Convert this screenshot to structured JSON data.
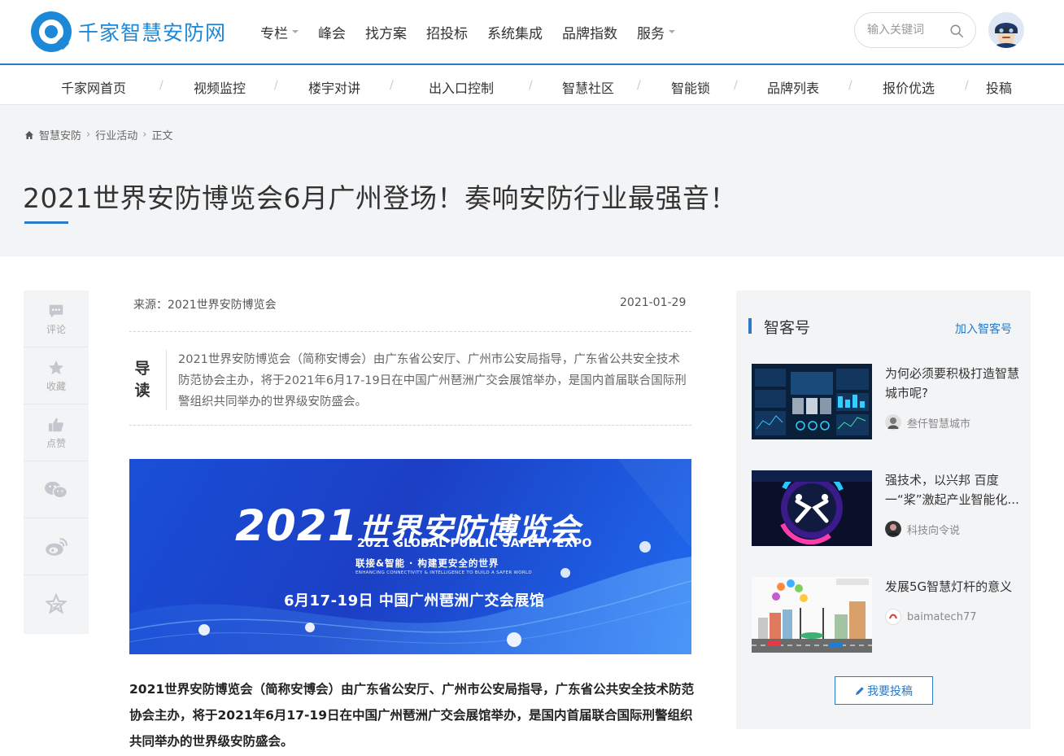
{
  "brand": {
    "name": "千家智慧安防网",
    "color": "#1e88d8",
    "accent": "#2a7ac7"
  },
  "main_nav": [
    {
      "label": "专栏",
      "has_dropdown": true
    },
    {
      "label": "峰会",
      "has_dropdown": false
    },
    {
      "label": "找方案",
      "has_dropdown": false
    },
    {
      "label": "招投标",
      "has_dropdown": false
    },
    {
      "label": "系统集成",
      "has_dropdown": false
    },
    {
      "label": "品牌指数",
      "has_dropdown": false
    },
    {
      "label": "服务",
      "has_dropdown": true
    }
  ],
  "search": {
    "placeholder": "输入关键词",
    "icon": "search-icon"
  },
  "sub_nav": [
    "千家网首页",
    "视频监控",
    "楼宇对讲",
    "出入口控制",
    "智慧社区",
    "智能锁",
    "品牌列表",
    "报价优选",
    "投稿"
  ],
  "breadcrumb": {
    "items": [
      "智慧安防",
      "行业活动",
      "正文"
    ]
  },
  "article": {
    "title": "2021世界安防博览会6月广州登场！奏响安防行业最强音！",
    "source": "来源：2021世界安防博览会",
    "date": "2021-01-29",
    "lead_label": "导读",
    "lead_text": "2021世界安防博览会（简称安博会）由广东省公安厅、广州市公安局指导，广东省公共安全技术防范协会主办，将于2021年6月17-19日在中国广州琶洲广交会展馆举办，是国内首届联合国际刑警组织共同举办的世界级安防盛会。",
    "body": "2021世界安防博览会（简称安博会）由广东省公安厅、广州市公安局指导，广东省公共安全技术防范协会主办，将于2021年6月17-19日在中国广州琶洲广交会展馆举办，是国内首届联合国际刑警组织共同举办的世界级安防盛会。"
  },
  "banner": {
    "year": "2021",
    "title_cn": "世界安防博览会",
    "title_en": "2021 GLOBAL PUBLIC SAFETY EXPO",
    "slogan": "联接&智能 · 构建更安全的世界",
    "slogan_en": "ENHANCING CONNECTIVITY & INTELLIGENCE TO BUILD A SAFER WORLD",
    "date_venue": "6月17-19日  中国广州琶洲广交会展馆"
  },
  "rail": [
    {
      "label": "评论",
      "icon": "comment-icon"
    },
    {
      "label": "收藏",
      "icon": "star-icon"
    },
    {
      "label": "点赞",
      "icon": "thumbs-up-icon"
    },
    {
      "label": "",
      "icon": "wechat-icon"
    },
    {
      "label": "",
      "icon": "weibo-icon"
    },
    {
      "label": "",
      "icon": "qzone-icon"
    }
  ],
  "sidebar": {
    "title": "智客号",
    "join_label": "加入智客号",
    "items": [
      {
        "title": "为何必须要积极打造智慧城市呢?",
        "author": "叁仟智慧城市"
      },
      {
        "title": "强技术，以兴邦 百度一“桨”激起产业智能化...",
        "author": "科技向令说"
      },
      {
        "title": "发展5G智慧灯杆的意义",
        "author": "baimatech77"
      }
    ],
    "submit_label": "我要投稿"
  }
}
